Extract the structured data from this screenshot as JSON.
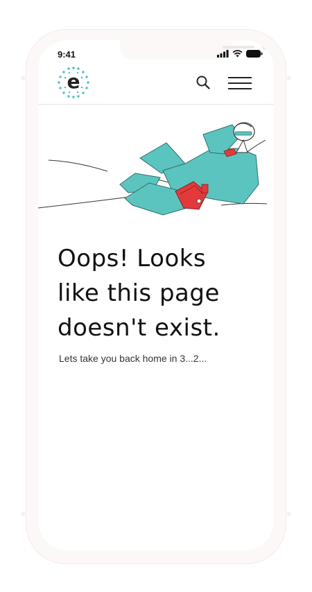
{
  "status_bar": {
    "time": "9:41"
  },
  "header": {
    "logo_letter": "e",
    "logo_dot_color": "#4cc0c3"
  },
  "error": {
    "title_lines": [
      "Oops! Looks",
      "like this page",
      "doesn't exist."
    ],
    "message": "Lets take you back home in 3...2..."
  },
  "colors": {
    "accent_teal": "#5cc4bf",
    "accent_red": "#e23a3a"
  },
  "icons": {
    "search": "search-icon",
    "menu": "hamburger-menu-icon"
  }
}
